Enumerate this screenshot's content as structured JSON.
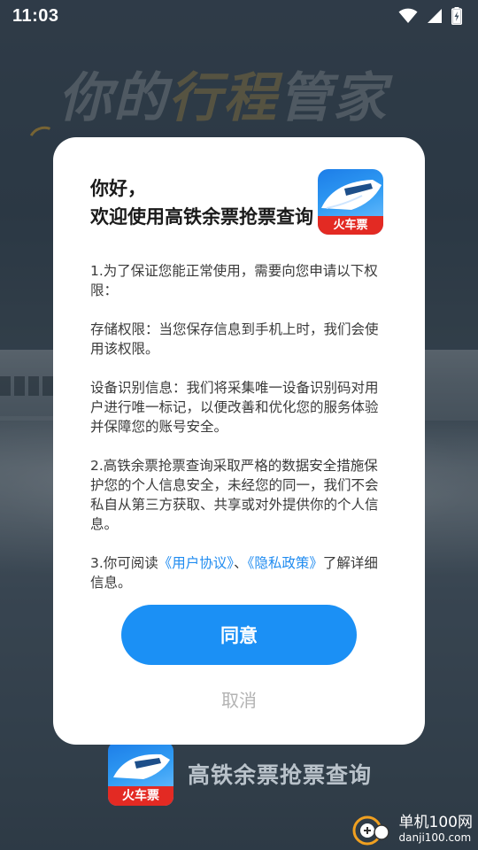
{
  "status_bar": {
    "time": "11:03",
    "icons": [
      "wifi-icon",
      "signal-icon",
      "battery-charging-icon"
    ]
  },
  "background": {
    "slogan_prefix": "你的",
    "slogan_highlight": "行程",
    "slogan_suffix": "管家"
  },
  "dialog": {
    "greeting": "你好，",
    "welcome": "欢迎使用高铁余票抢票查询",
    "logo_badge": "火车票",
    "paragraphs": {
      "p1": "1.为了保证您能正常使用，需要向您申请以下权限：",
      "p2": "存储权限：当您保存信息到手机上时，我们会使用该权限。",
      "p3": "设备识别信息：我们将采集唯一设备识别码对用户进行唯一标记，以便改善和优化您的服务体验并保障您的账号安全。",
      "p4": "2.高铁余票抢票查询采取严格的数据安全措施保护您的个人信息安全，未经您的同一，我们不会私自从第三方获取、共享或对外提供你的个人信息。",
      "p5_prefix": "3.你可阅读",
      "p5_link1": "《用户协议》",
      "p5_sep": "、",
      "p5_link2": "《隐私政策》",
      "p5_suffix": "了解详细信息。"
    },
    "agree_label": "同意",
    "cancel_label": "取消"
  },
  "brand": {
    "app_name": "高铁余票抢票查询",
    "logo_badge": "火车票"
  },
  "watermark": {
    "name": "单机100网",
    "domain": "danji100.com"
  },
  "colors": {
    "accent": "#1b90f5",
    "link": "#1f8bf0",
    "logo_red": "#e32a23"
  }
}
